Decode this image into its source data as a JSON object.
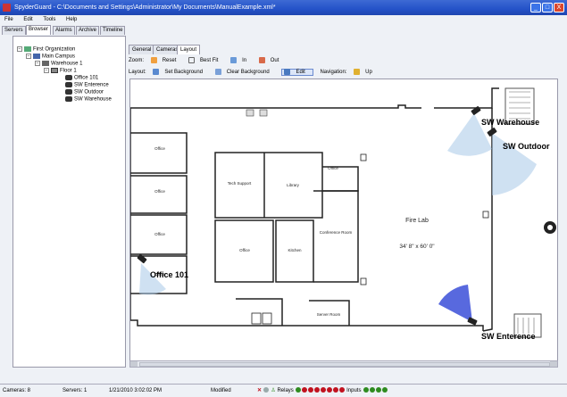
{
  "window": {
    "title": "SpyderGuard - C:\\Documents and Settings\\Administrator\\My Documents\\ManualExample.xml*",
    "minimize": "_",
    "maximize": "□",
    "close": "X"
  },
  "menu": [
    "File",
    "Edit",
    "Tools",
    "Help"
  ],
  "main_tabs": [
    "Servers",
    "Browser",
    "Alarms",
    "Archive",
    "Timeline"
  ],
  "tree": {
    "root": "First Organization",
    "campus": "Main Campus",
    "warehouse": "Warehouse 1",
    "floor": "Floor 1",
    "cameras": [
      "Office 101",
      "SW Enterence",
      "SW Outdoor",
      "SW Warehouse"
    ]
  },
  "content_tabs": [
    "General",
    "Cameras",
    "Layout"
  ],
  "zoom": {
    "label": "Zoom:",
    "reset": "Reset",
    "best_fit": "Best Fit",
    "in": "In",
    "out": "Out"
  },
  "layout": {
    "label": "Layout:",
    "set_background": "Set Background",
    "clear_background": "Clear Background",
    "edit": "Edit",
    "navigation_label": "Navigation:",
    "up": "Up"
  },
  "floorplan": {
    "rooms": {
      "office_a": "Office",
      "office_b": "Office",
      "office_c": "Office",
      "office_d": "Office",
      "office_e": "Office",
      "tech_support": "Tech Support",
      "library": "Library",
      "kitchen": "Kitchen",
      "conference": "Conference Room",
      "server_room": "Server Room",
      "fire_lab": "Fire Lab",
      "fire_lab_size": "34' 8\" x 60' 0\""
    },
    "camera_labels": {
      "sw_warehouse": "SW Warehouse",
      "sw_outdoor": "SW Outdoor",
      "office_101": "Office 101",
      "sw_enterence": "SW Enterence"
    }
  },
  "status": {
    "cameras": "Cameras: 8",
    "servers": "Servers: 1",
    "datetime": "1/21/2010 3:02:02 PM",
    "modified": "Modified",
    "relays_label": "Relays",
    "inputs_label": "Inputs"
  },
  "colors": {
    "relay_dot": "#c1121f",
    "input_dot": "#2e8b1f",
    "camera_fov": "#a8c8e8",
    "camera_fov_active": "#3b4fd8"
  }
}
